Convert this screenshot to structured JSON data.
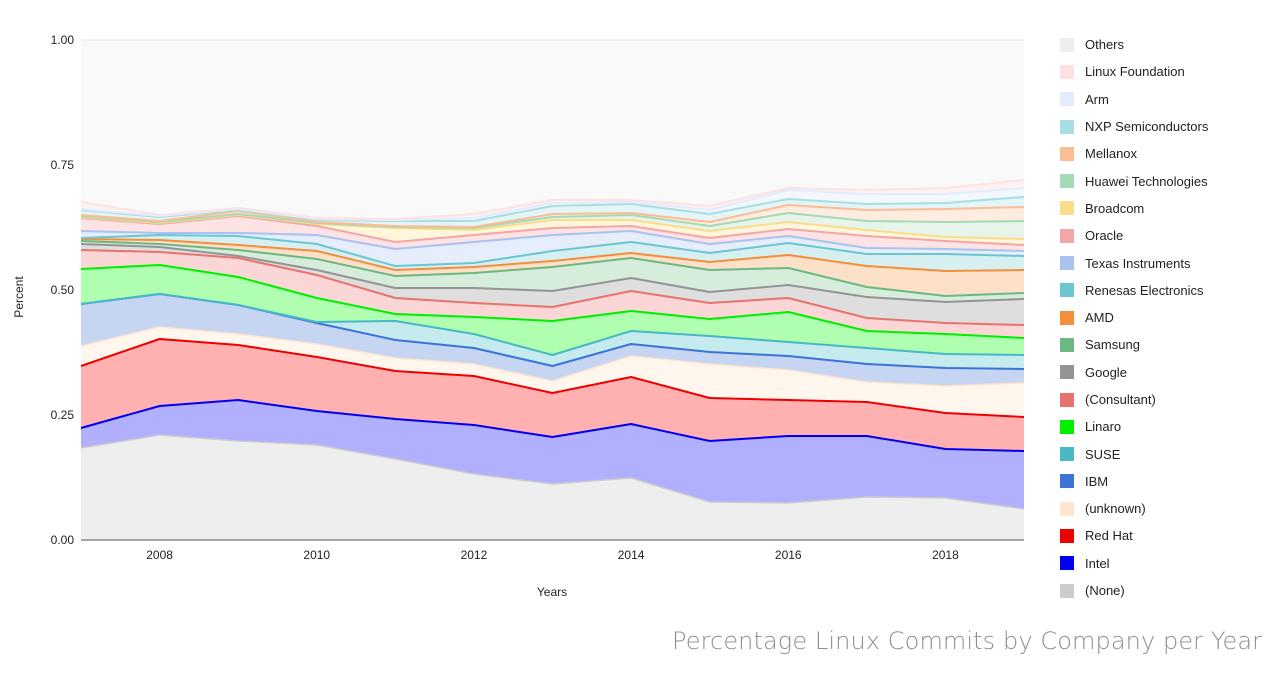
{
  "caption": "Percentage Linux Commits by Company per Year",
  "chart_data": {
    "type": "area",
    "stacked": true,
    "title": "Percentage Linux Commits by Company per Year",
    "xlabel": "Years",
    "ylabel": "Percent",
    "xlim": [
      2007,
      2019
    ],
    "ylim": [
      0,
      1
    ],
    "x_ticks": [
      "2008",
      "2010",
      "2012",
      "2014",
      "2016",
      "2018"
    ],
    "y_ticks": [
      "0.00",
      "0.25",
      "0.50",
      "0.75",
      "1.00"
    ],
    "grid": true,
    "legend_position": "right",
    "x": [
      2007,
      2008,
      2009,
      2010,
      2011,
      2012,
      2013,
      2014,
      2015,
      2016,
      2017,
      2018,
      2019
    ],
    "series": [
      {
        "name": "(None)",
        "color": "#cccccc",
        "fill": "#eeeeee",
        "line": false,
        "values": [
          0.184,
          0.21,
          0.198,
          0.19,
          0.162,
          0.132,
          0.112,
          0.124,
          0.076,
          0.074,
          0.086,
          0.084,
          0.062
        ]
      },
      {
        "name": "Intel",
        "color": "#0000ee",
        "fill": "#b0b0ff",
        "line": true,
        "values": [
          0.04,
          0.058,
          0.082,
          0.068,
          0.08,
          0.098,
          0.094,
          0.108,
          0.122,
          0.134,
          0.122,
          0.098,
          0.116
        ]
      },
      {
        "name": "Red Hat",
        "color": "#ee0000",
        "fill": "#ffb0b0",
        "line": true,
        "values": [
          0.124,
          0.134,
          0.11,
          0.108,
          0.096,
          0.098,
          0.088,
          0.094,
          0.086,
          0.072,
          0.068,
          0.072,
          0.068
        ]
      },
      {
        "name": "(unknown)",
        "color": "#fde5cf",
        "fill": "#fff6ee",
        "line": false,
        "values": [
          0.04,
          0.024,
          0.022,
          0.026,
          0.026,
          0.024,
          0.024,
          0.042,
          0.068,
          0.06,
          0.04,
          0.054,
          0.068
        ]
      },
      {
        "name": "IBM",
        "color": "#3a74d6",
        "fill": "#c6d6f2",
        "line": true,
        "values": [
          0.084,
          0.066,
          0.058,
          0.042,
          0.036,
          0.032,
          0.03,
          0.024,
          0.024,
          0.028,
          0.036,
          0.036,
          0.028
        ]
      },
      {
        "name": "SUSE",
        "color": "#46b8c6",
        "fill": "#c6ebee",
        "line": true,
        "values": [
          0.0,
          0.0,
          0.0,
          0.002,
          0.038,
          0.028,
          0.022,
          0.026,
          0.032,
          0.028,
          0.032,
          0.028,
          0.028
        ]
      },
      {
        "name": "Linaro",
        "color": "#00ee00",
        "fill": "#b0ffb0",
        "line": true,
        "values": [
          0.07,
          0.058,
          0.056,
          0.048,
          0.014,
          0.034,
          0.068,
          0.04,
          0.034,
          0.06,
          0.034,
          0.04,
          0.034
        ]
      },
      {
        "name": "(Consultant)",
        "color": "#e8736e",
        "fill": "#fad6d6",
        "line": true,
        "values": [
          0.038,
          0.026,
          0.038,
          0.046,
          0.032,
          0.028,
          0.028,
          0.04,
          0.032,
          0.028,
          0.026,
          0.022,
          0.026
        ]
      },
      {
        "name": "Google",
        "color": "#949494",
        "fill": "#dedede",
        "line": true,
        "values": [
          0.012,
          0.01,
          0.004,
          0.01,
          0.02,
          0.03,
          0.032,
          0.026,
          0.022,
          0.026,
          0.042,
          0.042,
          0.052
        ]
      },
      {
        "name": "Samsung",
        "color": "#6cb882",
        "fill": "#d6eddc",
        "line": true,
        "values": [
          0.006,
          0.006,
          0.012,
          0.022,
          0.024,
          0.03,
          0.048,
          0.04,
          0.044,
          0.034,
          0.02,
          0.012,
          0.012
        ]
      },
      {
        "name": "AMD",
        "color": "#f28e3c",
        "fill": "#fde0c8",
        "line": true,
        "values": [
          0.004,
          0.008,
          0.01,
          0.016,
          0.012,
          0.012,
          0.012,
          0.01,
          0.016,
          0.026,
          0.042,
          0.05,
          0.046
        ]
      },
      {
        "name": "Renesas Electronics",
        "color": "#6cc6cf",
        "fill": "#d6f0f2",
        "line": true,
        "values": [
          0.002,
          0.01,
          0.018,
          0.014,
          0.008,
          0.008,
          0.02,
          0.022,
          0.018,
          0.024,
          0.024,
          0.034,
          0.028
        ]
      },
      {
        "name": "Texas Instruments",
        "color": "#a8c2f2",
        "fill": "#e6eefc",
        "line": true,
        "values": [
          0.014,
          0.004,
          0.006,
          0.018,
          0.034,
          0.042,
          0.032,
          0.022,
          0.018,
          0.014,
          0.012,
          0.01,
          0.01
        ]
      },
      {
        "name": "Oracle",
        "color": "#f2a6a6",
        "fill": "#fde3e3",
        "line": true,
        "values": [
          0.026,
          0.018,
          0.034,
          0.018,
          0.014,
          0.014,
          0.014,
          0.01,
          0.012,
          0.014,
          0.024,
          0.016,
          0.012
        ]
      },
      {
        "name": "Broadcom",
        "color": "#fbdc8c",
        "fill": "#fff6dc",
        "line": true,
        "values": [
          0.002,
          0.002,
          0.002,
          0.004,
          0.028,
          0.01,
          0.016,
          0.012,
          0.014,
          0.014,
          0.012,
          0.008,
          0.012
        ]
      },
      {
        "name": "Huawei Technologies",
        "color": "#a6d9b6",
        "fill": "#e6f4ea",
        "line": true,
        "values": [
          0.002,
          0.002,
          0.002,
          0.002,
          0.002,
          0.004,
          0.006,
          0.01,
          0.01,
          0.018,
          0.018,
          0.03,
          0.036
        ]
      },
      {
        "name": "Mellanox",
        "color": "#fbbd94",
        "fill": "#feece0",
        "line": true,
        "values": [
          0.002,
          0.002,
          0.006,
          0.002,
          0.002,
          0.002,
          0.006,
          0.004,
          0.008,
          0.016,
          0.022,
          0.026,
          0.028
        ]
      },
      {
        "name": "NXP Semiconductors",
        "color": "#a8dde2",
        "fill": "#e4f5f7",
        "line": true,
        "values": [
          0.01,
          0.008,
          0.002,
          0.004,
          0.01,
          0.012,
          0.016,
          0.018,
          0.016,
          0.012,
          0.012,
          0.012,
          0.02
        ]
      },
      {
        "name": "Arm",
        "color": "#e2ecfc",
        "fill": "#f3f7fe",
        "line": true,
        "values": [
          0.002,
          0.002,
          0.002,
          0.002,
          0.002,
          0.006,
          0.006,
          0.004,
          0.008,
          0.018,
          0.02,
          0.018,
          0.018
        ]
      },
      {
        "name": "Linux Foundation",
        "color": "#fde2e4",
        "fill": "#fef2f3",
        "line": true,
        "values": [
          0.014,
          0.002,
          0.002,
          0.002,
          0.002,
          0.008,
          0.006,
          0.004,
          0.008,
          0.004,
          0.008,
          0.012,
          0.016
        ]
      },
      {
        "name": "Others",
        "color": "#eeeeee",
        "fill": "#f9f9f9",
        "line": false,
        "values": [
          0.324,
          0.35,
          0.336,
          0.356,
          0.358,
          0.348,
          0.32,
          0.32,
          0.332,
          0.296,
          0.3,
          0.296,
          0.28
        ]
      }
    ],
    "legend_order": [
      "Others",
      "Linux Foundation",
      "Arm",
      "NXP Semiconductors",
      "Mellanox",
      "Huawei Technologies",
      "Broadcom",
      "Oracle",
      "Texas Instruments",
      "Renesas Electronics",
      "AMD",
      "Samsung",
      "Google",
      "(Consultant)",
      "Linaro",
      "SUSE",
      "IBM",
      "(unknown)",
      "Red Hat",
      "Intel",
      "(None)"
    ]
  }
}
